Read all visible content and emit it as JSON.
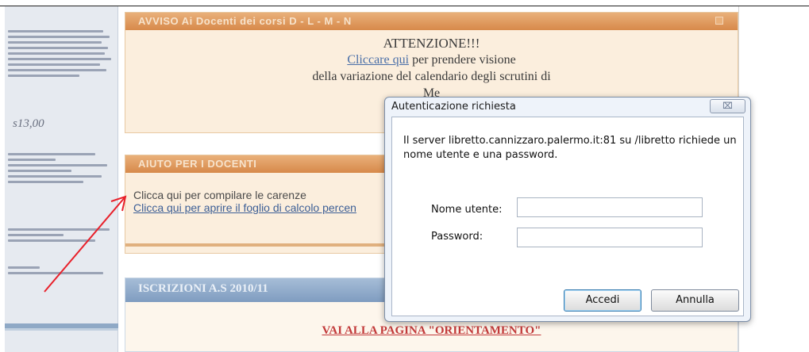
{
  "avviso": {
    "header": "AVVISO Ai Docenti dei corsi D - L - M - N",
    "title": "ATTENZIONE!!!",
    "link": "Cliccare qui",
    "line1_rest": " per prendere visione",
    "line2": "della variazione del calendario degli scrutini di",
    "line3": "Me"
  },
  "aiuto": {
    "header": "AIUTO PER I DOCENTI",
    "link1": "Clicca qui per compilare le carenze",
    "link2": "Clicca qui per aprire il foglio di calcolo percen"
  },
  "iscrizioni": {
    "header": "ISCRIZIONI A.S 2010/11",
    "link": "VAI ALLA PAGINA \"ORIENTAMENTO\""
  },
  "sidebar": {
    "signature": "s13,00"
  },
  "dialog": {
    "title": "Autenticazione richiesta",
    "message": "Il server libretto.cannizzaro.palermo.it:81 su /libretto richiede un nome utente e una password.",
    "username_label": "Nome utente:",
    "username_value": "",
    "password_label": "Password:",
    "password_value": "",
    "ok_label": "Accedi",
    "cancel_label": "Annulla",
    "close_glyph": "⌧"
  },
  "colors": {
    "accent_orange": "#d7894a",
    "accent_blue": "#7f9cc0",
    "arrow_red": "#e8202a",
    "link_red": "#c23a3a"
  }
}
